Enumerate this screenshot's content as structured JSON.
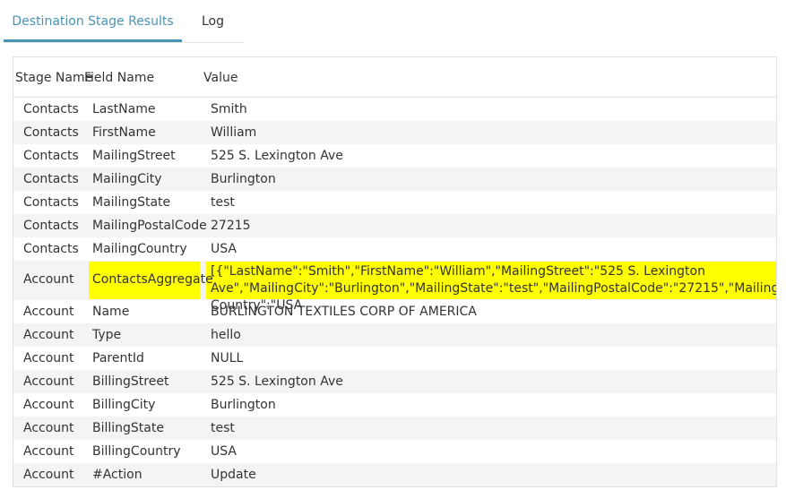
{
  "tabs": [
    {
      "label": "Destination Stage Results",
      "active": true
    },
    {
      "label": "Log",
      "active": false
    }
  ],
  "table": {
    "columns": [
      "Stage Name",
      "Field Name",
      "Value"
    ],
    "rows": [
      {
        "stage": "Contacts",
        "field": "LastName",
        "value": "Smith"
      },
      {
        "stage": "Contacts",
        "field": "FirstName",
        "value": "William"
      },
      {
        "stage": "Contacts",
        "field": "MailingStreet",
        "value": "525 S. Lexington Ave"
      },
      {
        "stage": "Contacts",
        "field": "MailingCity",
        "value": "Burlington"
      },
      {
        "stage": "Contacts",
        "field": "MailingState",
        "value": "test"
      },
      {
        "stage": "Contacts",
        "field": "MailingPostalCode",
        "value": "27215"
      },
      {
        "stage": "Contacts",
        "field": "MailingCountry",
        "value": "USA"
      },
      {
        "stage": "Account",
        "field": "ContactsAggregate",
        "value": "[{\"LastName\":\"Smith\",\"FirstName\":\"William\",\"MailingStreet\":\"525 S. Lexington Ave\",\"MailingCity\":\"Burlington\",\"MailingState\":\"test\",\"MailingPostalCode\":\"27215\",\"MailingCountry\":\"USA",
        "highlighted": true
      },
      {
        "stage": "Account",
        "field": "Name",
        "value": "BURLINGTON TEXTILES CORP OF AMERICA"
      },
      {
        "stage": "Account",
        "field": "Type",
        "value": "hello"
      },
      {
        "stage": "Account",
        "field": "ParentId",
        "value": "NULL"
      },
      {
        "stage": "Account",
        "field": "BillingStreet",
        "value": "525 S. Lexington Ave"
      },
      {
        "stage": "Account",
        "field": "BillingCity",
        "value": "Burlington"
      },
      {
        "stage": "Account",
        "field": "BillingState",
        "value": "test"
      },
      {
        "stage": "Account",
        "field": "BillingCountry",
        "value": "USA"
      },
      {
        "stage": "Account",
        "field": "#Action",
        "value": "Update"
      }
    ]
  },
  "colors": {
    "accent": "#4a93b5",
    "highlight": "#ffff00",
    "row_alt": "#f4f4f4"
  }
}
